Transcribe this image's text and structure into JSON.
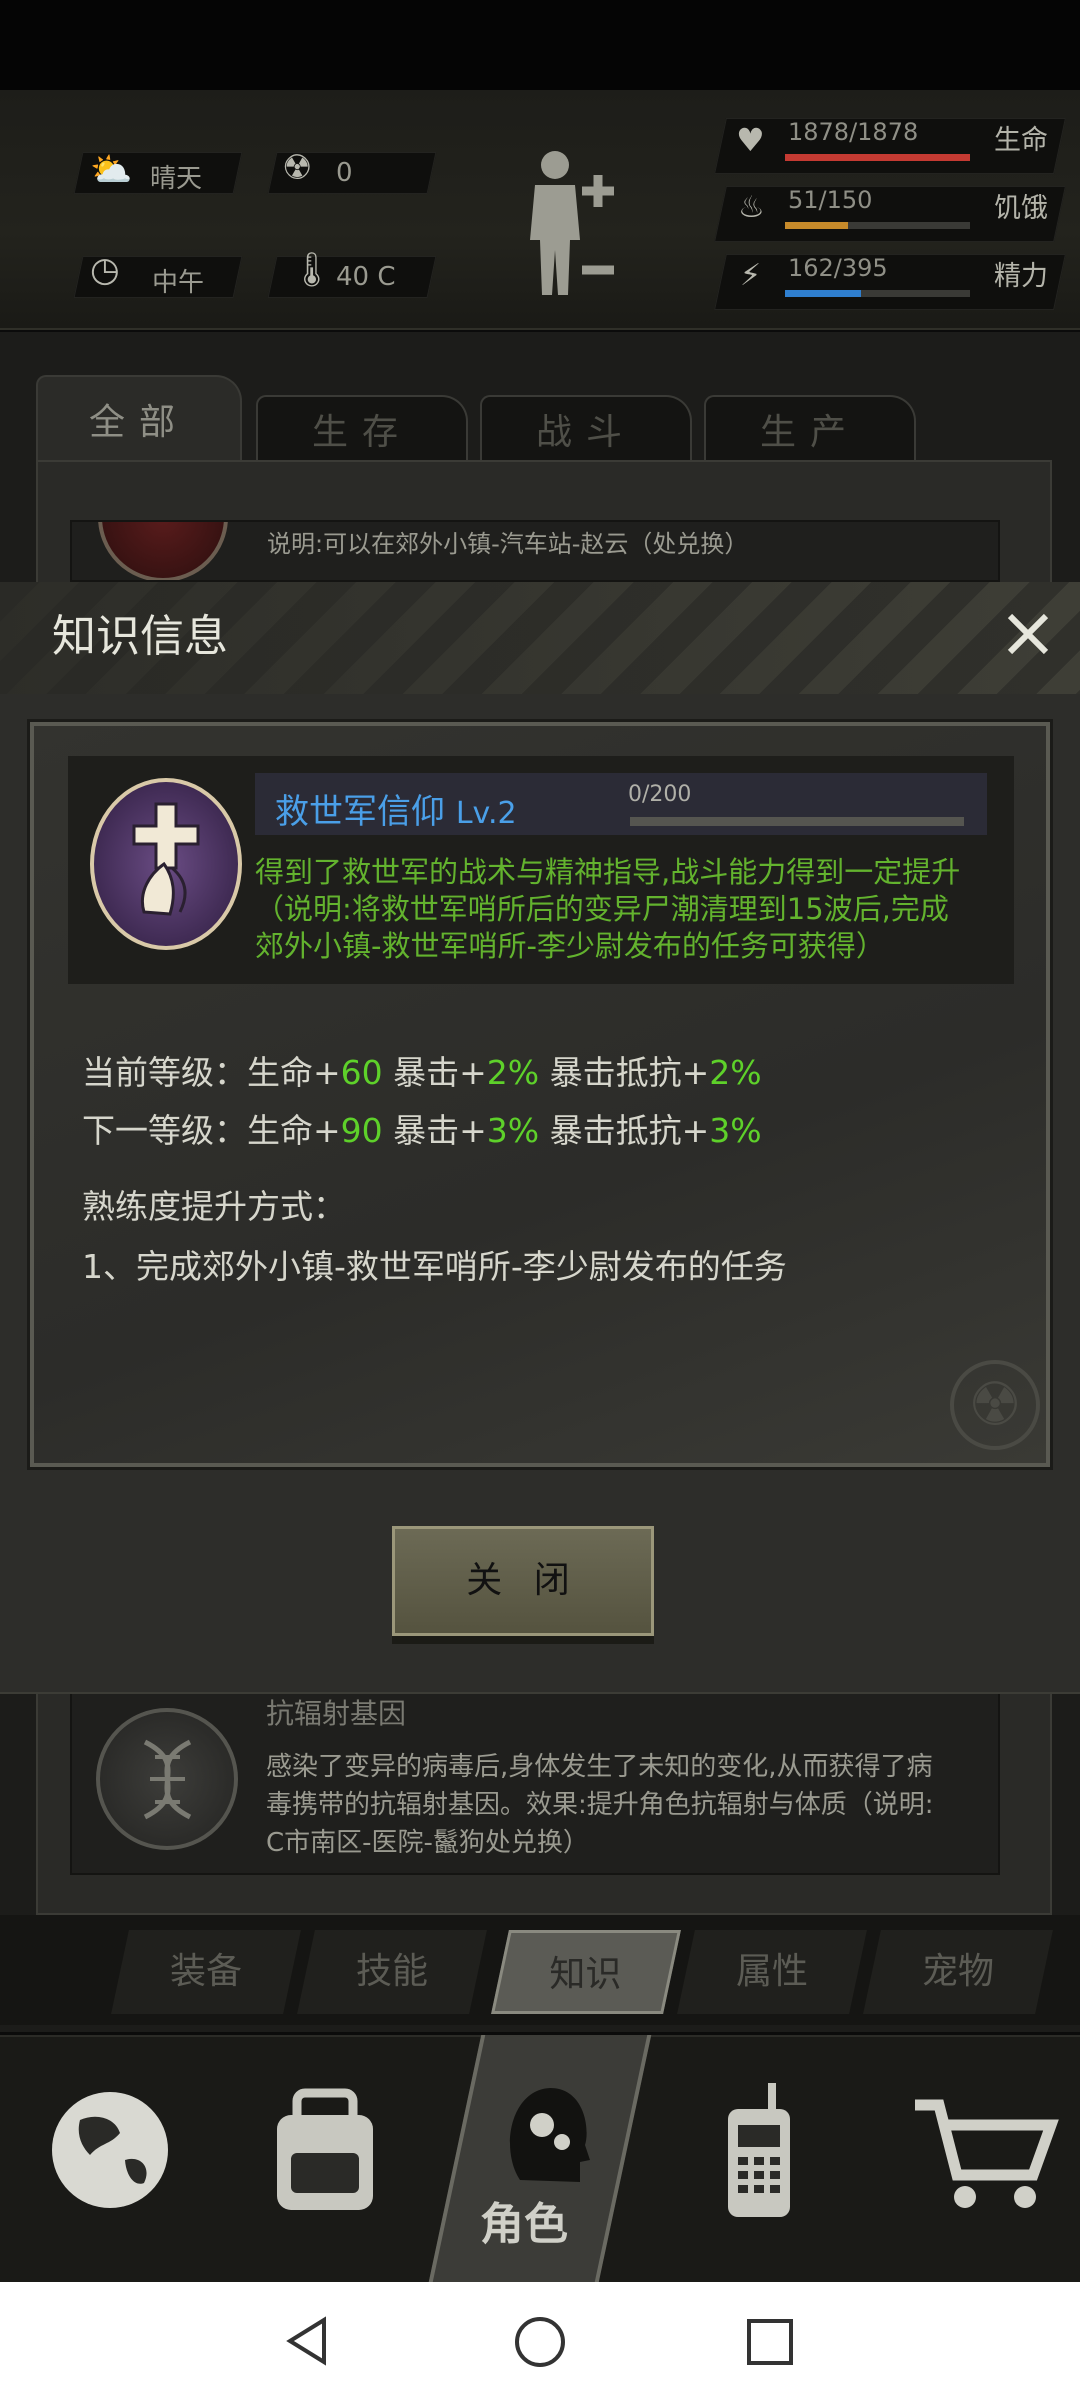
{
  "hud": {
    "weather": "晴天",
    "radiation": "0",
    "time_of_day": "中午",
    "temperature": "40 C",
    "life": {
      "value": "1878/1878",
      "label": "生命",
      "fill": 1.0,
      "color": "#c43a32"
    },
    "hunger": {
      "value": "51/150",
      "label": "饥饿",
      "fill": 0.34,
      "color": "#c78a2a"
    },
    "energy": {
      "value": "162/395",
      "label": "精力",
      "fill": 0.41,
      "color": "#2f7fcf"
    }
  },
  "tabs": [
    "全部",
    "生存",
    "战斗",
    "生产"
  ],
  "list_items": {
    "top_desc": "说明:可以在郊外小镇-汽车站-赵云（处兑换）",
    "bottom_title": "抗辐射基因",
    "bottom_desc_1": "感染了变异的病毒后,身体发生了未知的变化,从而获得了病",
    "bottom_desc_2": "毒携带的抗辐射基因。效果:提升角色抗辐射与体质（说明:",
    "bottom_desc_3": "C市南区-医院-鬣狗处兑换）"
  },
  "modal": {
    "title": "知识信息",
    "skill_name": "救世军信仰",
    "skill_level": "Lv.2",
    "progress_text": "0/200",
    "progress": 0.0,
    "desc_1": "得到了救世军的战术与精神指导,战斗能力得到一定提升",
    "desc_2": "（说明:将救世军哨所后的变异尸潮清理到15波后,完成",
    "desc_3": "郊外小镇-救世军哨所-李少尉发布的任务可获得）",
    "current_label": "当前等级：生命+",
    "current_life": "60",
    "crit_label": " 暴击+",
    "current_crit": "2%",
    "crit_res_label": " 暴击抵抗+",
    "current_crit_res": "2%",
    "next_label": "下一等级：生命+",
    "next_life": "90",
    "next_crit": "3%",
    "next_crit_res": "3%",
    "method_title": "熟练度提升方式：",
    "method_1": "1、完成郊外小镇-救世军哨所-李少尉发布的任务",
    "close_label": "关 闭"
  },
  "subtabs": [
    "装备",
    "技能",
    "知识",
    "属性",
    "宠物"
  ],
  "nav": {
    "role_label": "角色"
  }
}
